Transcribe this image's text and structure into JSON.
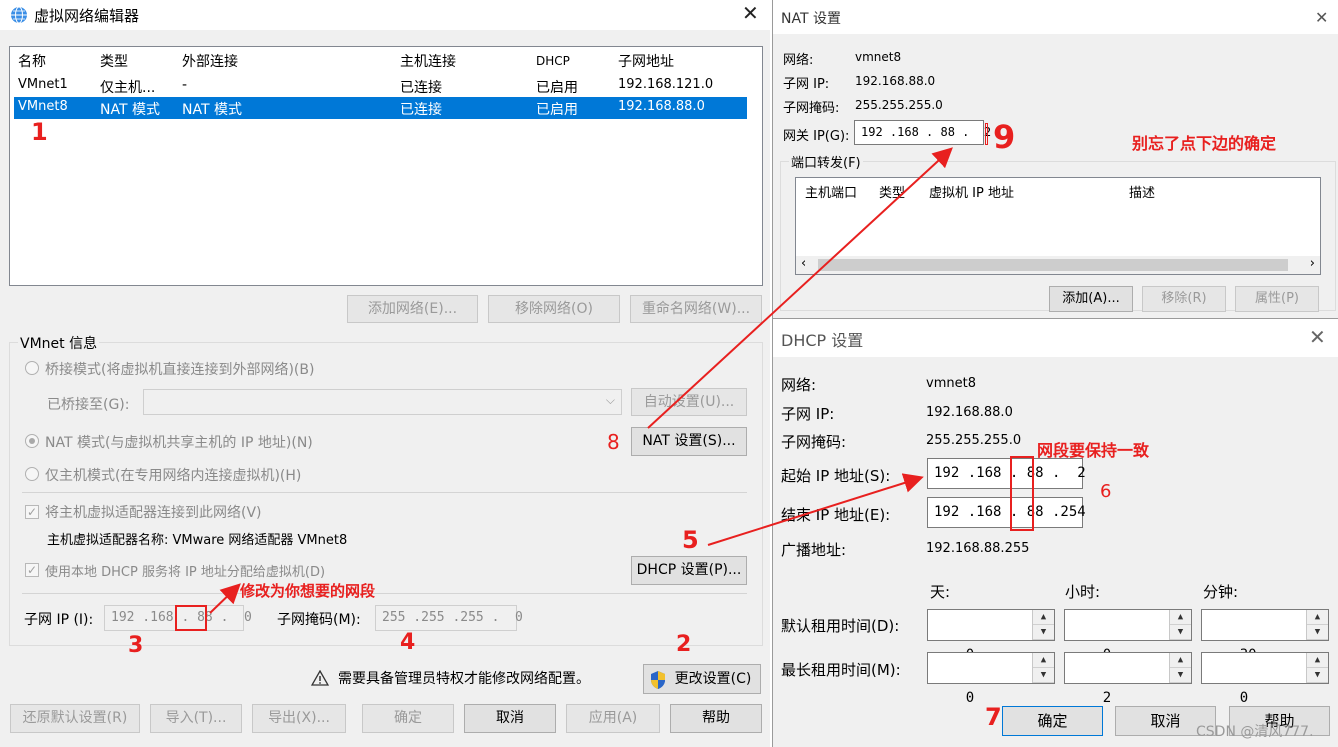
{
  "vne": {
    "title": "虚拟网络编辑器",
    "columns": [
      "名称",
      "类型",
      "外部连接",
      "主机连接",
      "DHCP",
      "子网地址"
    ],
    "rows": [
      [
        "VMnet1",
        "仅主机...",
        "-",
        "已连接",
        "已启用",
        "192.168.121.0"
      ],
      [
        "VMnet8",
        "NAT 模式",
        "NAT 模式",
        "已连接",
        "已启用",
        "192.168.88.0"
      ]
    ],
    "add_network": "添加网络(E)...",
    "remove_network": "移除网络(O)",
    "rename_network": "重命名网络(W)...",
    "group_title": "VMnet 信息",
    "bridged_mode": "桥接模式(将虚拟机直接连接到外部网络)(B)",
    "bridged_to_label": "已桥接至(G):",
    "auto_settings": "自动设置(U)...",
    "nat_mode": "NAT 模式(与虚拟机共享主机的 IP 地址)(N)",
    "nat_settings": "NAT 设置(S)...",
    "host_only_mode": "仅主机模式(在专用网络内连接虚拟机)(H)",
    "connect_adapter": "将主机虚拟适配器连接到此网络(V)",
    "adapter_name": "主机虚拟适配器名称: VMware 网络适配器 VMnet8",
    "use_dhcp": "使用本地 DHCP 服务将 IP 地址分配给虚拟机(D)",
    "dhcp_settings": "DHCP 设置(P)...",
    "subnet_ip_label": "子网 IP (I):",
    "subnet_ip": "192 .168 . 88 .  0",
    "subnet_mask_label": "子网掩码(M):",
    "subnet_mask": "255 .255 .255 .  0",
    "admin_note": "需要具备管理员特权才能修改网络配置。",
    "change_settings": "更改设置(C)",
    "restore_defaults": "还原默认设置(R)",
    "import": "导入(T)...",
    "export": "导出(X)...",
    "ok": "确定",
    "cancel": "取消",
    "apply": "应用(A)",
    "help": "帮助"
  },
  "nat": {
    "title": "NAT 设置",
    "network_label": "网络:",
    "network_value": "vmnet8",
    "subnet_ip_label": "子网 IP:",
    "subnet_ip_value": "192.168.88.0",
    "subnet_mask_label": "子网掩码:",
    "subnet_mask_value": "255.255.255.0",
    "gateway_label": "网关 IP(G):",
    "gateway_value": "192 .168 . 88 .  2",
    "port_forward_label": "端口转发(F)",
    "pf_columns": [
      "主机端口",
      "类型",
      "虚拟机 IP 地址",
      "描述"
    ],
    "add": "添加(A)...",
    "remove": "移除(R)",
    "properties": "属性(P)"
  },
  "dhcp": {
    "title": "DHCP 设置",
    "network_label": "网络:",
    "network_value": "vmnet8",
    "subnet_ip_label": "子网 IP:",
    "subnet_ip_value": "192.168.88.0",
    "subnet_mask_label": "子网掩码:",
    "subnet_mask_value": "255.255.255.0",
    "start_ip_label": "起始 IP 地址(S):",
    "start_ip": "192 .168 . 88 .  2",
    "end_ip_label": "结束 IP 地址(E):",
    "end_ip": "192 .168 . 88 .254",
    "broadcast_label": "广播地址:",
    "broadcast_value": "192.168.88.255",
    "days_label": "天:",
    "hours_label": "小时:",
    "minutes_label": "分钟:",
    "default_lease_label": "默认租用时间(D):",
    "default_lease": [
      "0",
      "0",
      "30"
    ],
    "max_lease_label": "最长租用时间(M):",
    "max_lease": [
      "0",
      "2",
      "0"
    ],
    "ok": "确定",
    "cancel": "取消",
    "help": "帮助"
  },
  "annotations": {
    "n1": "1",
    "n2": "2",
    "n3": "3",
    "n4": "4",
    "n5": "5",
    "n6": "6",
    "n7": "7",
    "n8": "8",
    "n9": "9",
    "modify_subnet": "修改为你想要的网段",
    "keep_consistent": "网段要保持一致",
    "dont_forget_ok": "别忘了点下边的确定"
  },
  "watermark": "CSDN @清风777.",
  "colors": {
    "selection": "#0078d7",
    "annotation": "#e8201f"
  }
}
